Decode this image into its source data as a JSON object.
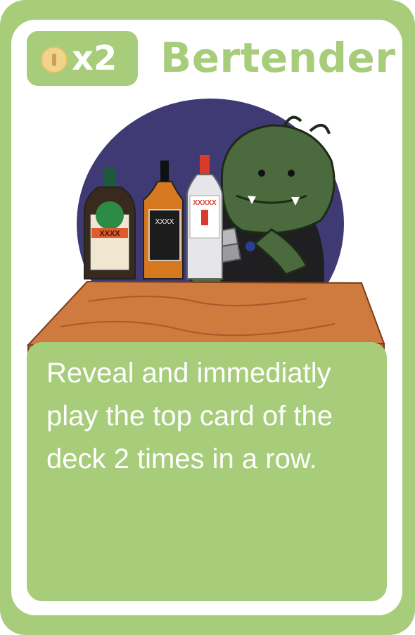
{
  "card": {
    "title": "Bertender",
    "cost": {
      "icon": "coin-icon",
      "multiplier": "x2"
    },
    "description": "Reveal and immediatly play the top card of the deck 2 times in a row.",
    "illustration": {
      "bottle_labels": [
        "XXXX",
        "XXXX",
        "XXXXX"
      ]
    },
    "colors": {
      "frame": "#a7cc7a",
      "inner": "#ffffff",
      "coin": "#f2d38c",
      "night": "#3f3a74",
      "monster": "#4b6a3d",
      "counter": "#cf7a3e"
    }
  }
}
